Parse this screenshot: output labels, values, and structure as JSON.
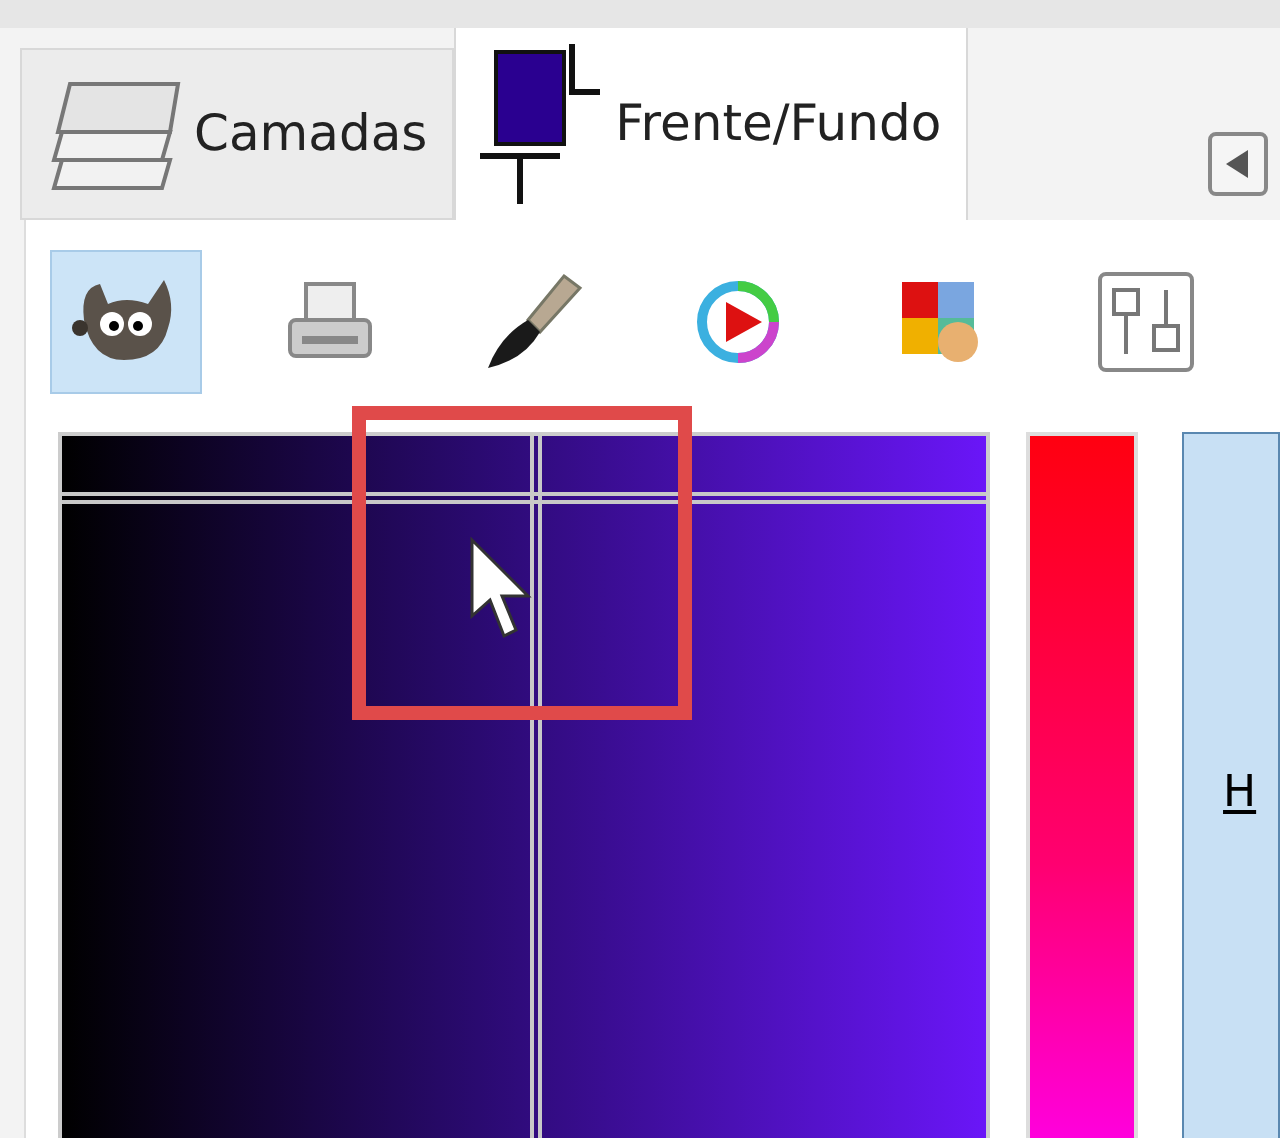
{
  "tabs": [
    {
      "kind": "layers",
      "label": "Camadas",
      "selected": false
    },
    {
      "kind": "fgbg",
      "label": "Frente/Fundo",
      "selected": true
    }
  ],
  "tool_buttons": [
    {
      "selected": true
    },
    {
      "selected": false
    },
    {
      "selected": false
    },
    {
      "selected": false
    },
    {
      "selected": false
    },
    {
      "selected": false
    }
  ],
  "channel_button": {
    "label": "H",
    "selected": true
  }
}
